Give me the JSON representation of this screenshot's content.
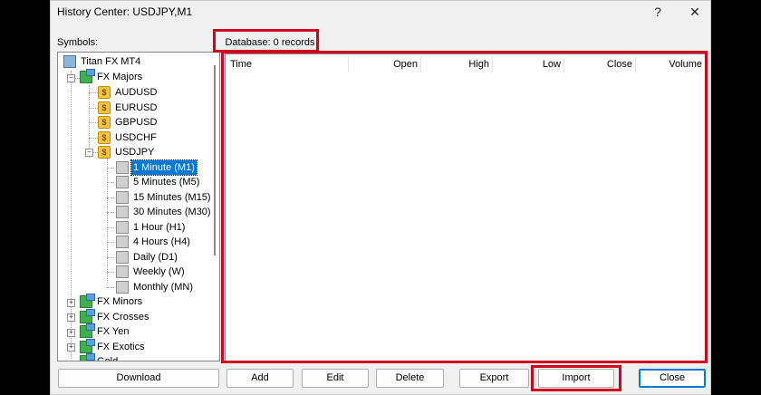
{
  "window": {
    "title": "History Center: USDJPY,M1",
    "help": "?",
    "close": "✕"
  },
  "symbols_label": "Symbols:",
  "database_label": "Database: 0 records",
  "tree": {
    "server": "Titan FX MT4",
    "groups": [
      {
        "name": "FX Majors",
        "expanded": true
      },
      {
        "name": "FX Minors",
        "expanded": false
      },
      {
        "name": "FX Crosses",
        "expanded": false
      },
      {
        "name": "FX Yen",
        "expanded": false
      },
      {
        "name": "FX Exotics",
        "expanded": false
      },
      {
        "name": "Gold",
        "expanded": false
      }
    ],
    "symbols": [
      "AUDUSD",
      "EURUSD",
      "GBPUSD",
      "USDCHF",
      "USDJPY"
    ],
    "periods": [
      "1 Minute (M1)",
      "5 Minutes (M5)",
      "15 Minutes (M15)",
      "30 Minutes (M30)",
      "1 Hour (H1)",
      "4 Hours (H4)",
      "Daily (D1)",
      "Weekly (W)",
      "Monthly (MN)"
    ],
    "selected_period": "1 Minute (M1)"
  },
  "grid": {
    "columns": [
      "Time",
      "Open",
      "High",
      "Low",
      "Close",
      "Volume"
    ],
    "rows": []
  },
  "buttons": {
    "download": "Download",
    "add": "Add",
    "edit": "Edit",
    "delete": "Delete",
    "export": "Export",
    "import": "Import",
    "close": "Close"
  },
  "colors": {
    "highlight": "#d0021b",
    "selection": "#0078d7"
  }
}
